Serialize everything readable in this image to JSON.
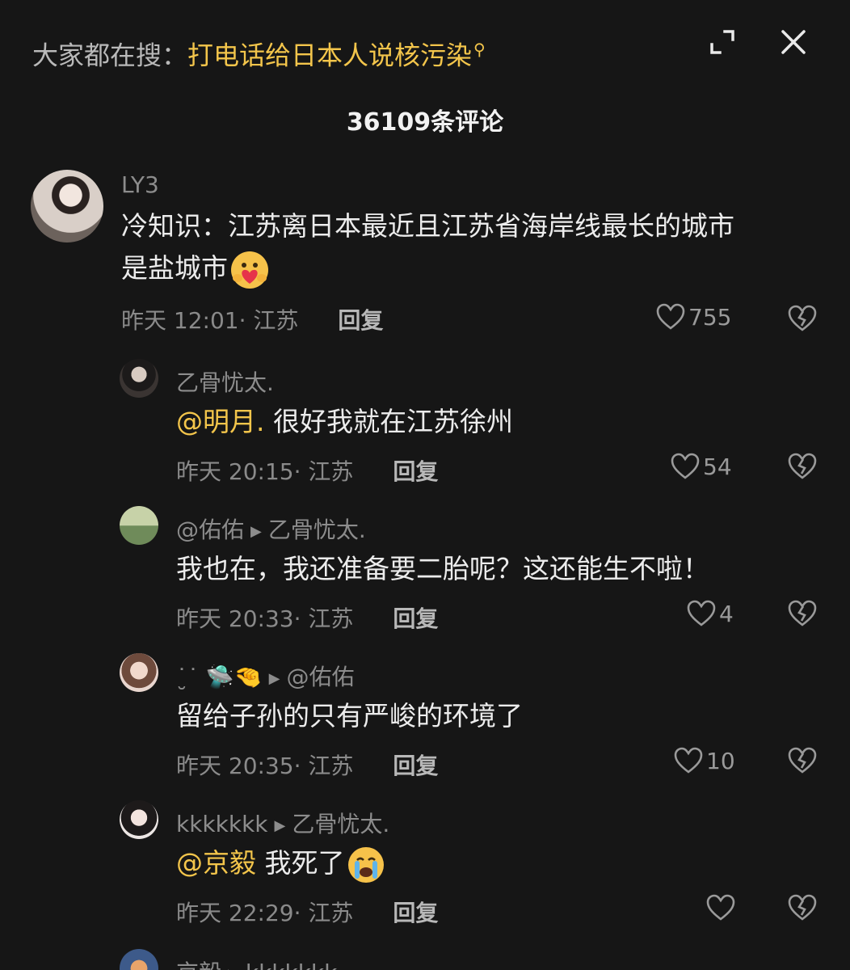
{
  "header": {
    "search_prefix": "大家都在搜：",
    "search_term": "打电话给日本人说核污染",
    "comment_count": "36109条评论",
    "expand_icon": "expand-icon",
    "close_icon": "close-icon"
  },
  "comments": [
    {
      "username": "LY3",
      "text_lines": [
        "冷知识：江苏离日本最近且江苏省海岸线最长的城市",
        "是盐城市"
      ],
      "emoji": "heart-hug-emoji",
      "time": "昨天 12:01",
      "location": "· 江苏",
      "reply_label": "回复",
      "likes": "755"
    },
    {
      "username": "乙骨忧太.",
      "mention": "@明月.",
      "text": "很好我就在江苏徐州",
      "time": "昨天 20:15",
      "location": "· 江苏",
      "reply_label": "回复",
      "likes": "54"
    },
    {
      "username": "@佑佑",
      "reply_to": "乙骨忧太.",
      "text": "我也在，我还准备要二胎呢？这还能生不啦！",
      "time": "昨天 20:33",
      "location": "· 江苏",
      "reply_label": "回复",
      "likes": "4"
    },
    {
      "username": "˙̮˙  🛸🤏",
      "reply_to": "@佑佑",
      "text": "留给子孙的只有严峻的环境了",
      "time": "昨天 20:35",
      "location": "· 江苏",
      "reply_label": "回复",
      "likes": "10"
    },
    {
      "username": "kkkkkkk",
      "reply_to": "乙骨忧太.",
      "mention": "@京毅",
      "text": "我死了",
      "emoji": "crying-emoji",
      "time": "昨天 22:29",
      "location": "· 江苏",
      "reply_label": "回复",
      "likes": ""
    },
    {
      "username": "京毅",
      "reply_to": "kkkkkkk"
    }
  ],
  "colors": {
    "background": "#161616",
    "accent": "#f3c54b",
    "muted": "#8c8c8c"
  }
}
